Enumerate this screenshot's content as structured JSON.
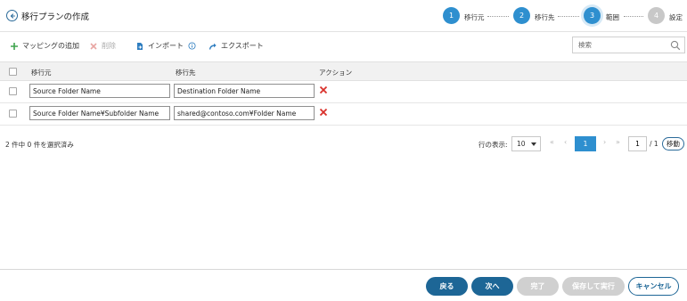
{
  "header": {
    "title": "移行プランの作成",
    "steps": [
      {
        "number": "1",
        "label": "移行元",
        "state": "done"
      },
      {
        "number": "2",
        "label": "移行先",
        "state": "done"
      },
      {
        "number": "3",
        "label": "範囲",
        "state": "current"
      },
      {
        "number": "4",
        "label": "設定",
        "state": "pending"
      }
    ]
  },
  "toolbar": {
    "add_mapping": "マッピングの追加",
    "delete": "削除",
    "import": "インポート",
    "export": "エクスポート",
    "search_placeholder": "検索"
  },
  "table": {
    "columns": [
      "移行元",
      "移行先",
      "アクション"
    ],
    "rows": [
      {
        "source": "Source Folder Name",
        "destination": "Destination Folder Name"
      },
      {
        "source": "Source Folder Name¥Subfolder Name",
        "destination": "shared@contoso.com¥Folder Name"
      }
    ]
  },
  "pagination": {
    "selection_status": "2 件中 0 件を選択済み",
    "rows_label": "行の表示:",
    "rows_per_page": "10",
    "current_page": "1",
    "page_input": "1",
    "total_pages": "/ 1",
    "move_label": "移動"
  },
  "footer": {
    "back": "戻る",
    "next": "次へ",
    "finish": "完了",
    "save_run": "保存して実行",
    "cancel": "キャンセル"
  },
  "colors": {
    "accent": "#2e8fcf",
    "primary_button": "#1d6696",
    "delete_icon": "#d9312b",
    "add_icon": "#3fa34d"
  }
}
